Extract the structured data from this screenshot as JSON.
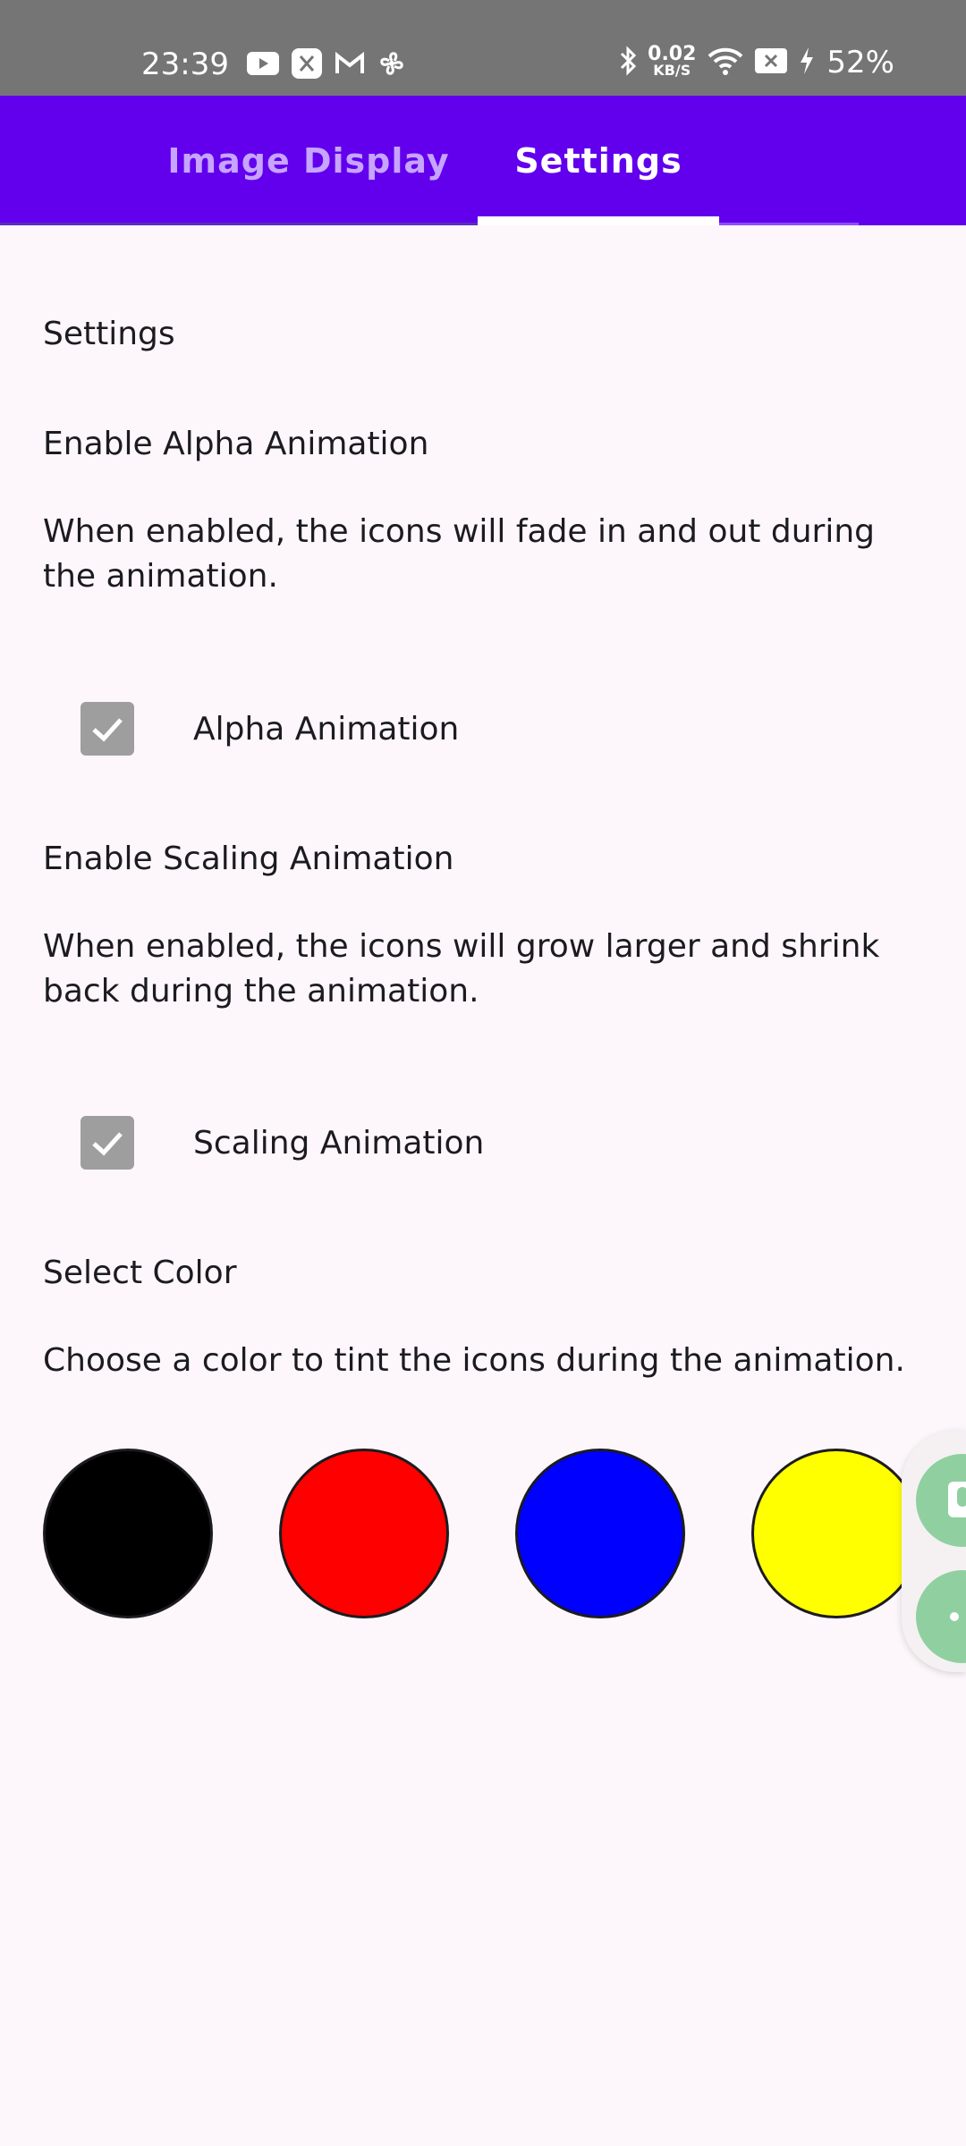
{
  "status_bar": {
    "time": "23:39",
    "left_icons": [
      "youtube-icon",
      "bug-icon",
      "gmail-icon",
      "fan-icon"
    ],
    "net_speed_value": "0.02",
    "net_speed_unit": "KB/S",
    "right_icons": [
      "bluetooth-icon",
      "wifi-icon",
      "battery-x-icon",
      "charging-icon"
    ],
    "battery": "52%"
  },
  "tabs": [
    {
      "label": "Image Display",
      "selected": false
    },
    {
      "label": "Settings",
      "selected": true
    }
  ],
  "content": {
    "heading": "Settings",
    "alpha": {
      "title": "Enable Alpha Animation",
      "description": "When enabled, the icons will fade in and out during the animation.",
      "checkbox_label": "Alpha Animation",
      "checked": true
    },
    "scaling": {
      "title": "Enable Scaling Animation",
      "description": "When enabled, the icons will grow larger and shrink back during the animation.",
      "checkbox_label": "Scaling Animation",
      "checked": true
    },
    "color": {
      "title": "Select Color",
      "description": "Choose a color to tint the icons during the animation.",
      "swatches": [
        "#000000",
        "#ff0000",
        "#0000ff",
        "#ffff00"
      ]
    }
  },
  "floating_panel": {
    "buttons": [
      "microphone-icon",
      "more-dots-icon"
    ]
  },
  "colors": {
    "status_bar": "#757575",
    "tab_bar": "#6200ee",
    "tab_unselected_text": "#c7a4ff",
    "background": "#fdf7fb",
    "checkbox": "#9e9e9e",
    "float_button": "#90d0a0"
  }
}
